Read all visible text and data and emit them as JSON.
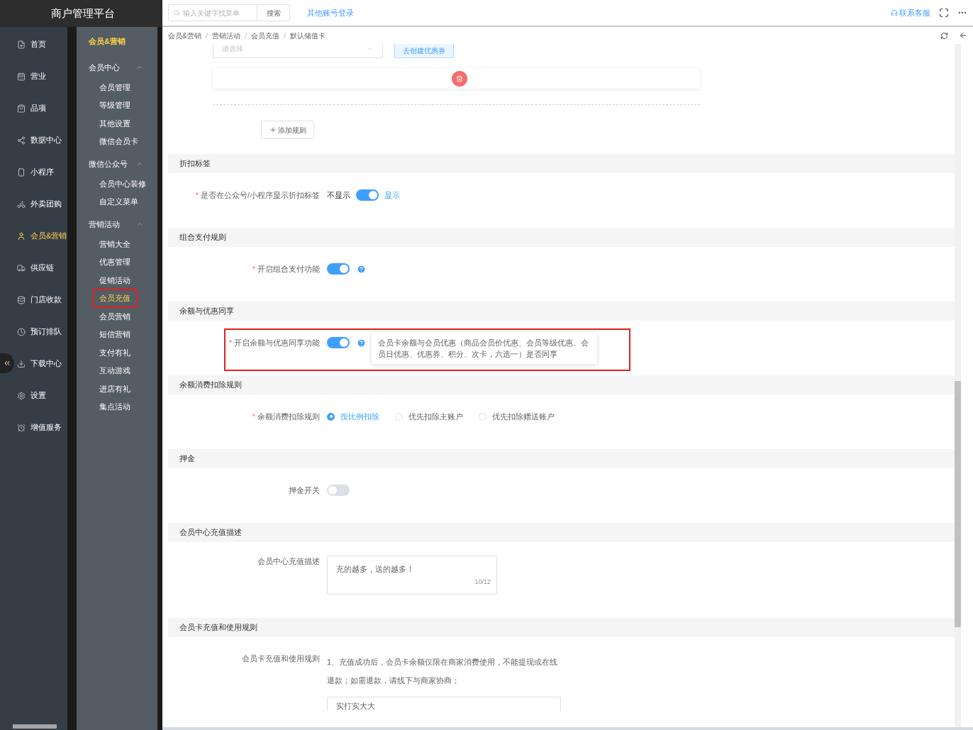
{
  "app_title": "商户管理平台",
  "header": {
    "search_placeholder": "输入关键字找菜单",
    "search_button": "搜索",
    "switch_account": "其他账号登录",
    "support": "联系客服"
  },
  "nav": [
    {
      "label": "首页",
      "selected": false
    },
    {
      "label": "营业",
      "selected": false
    },
    {
      "label": "品项",
      "selected": false
    },
    {
      "label": "数据中心",
      "selected": false
    },
    {
      "label": "小程序",
      "selected": false
    },
    {
      "label": "外卖团购",
      "selected": false
    },
    {
      "label": "会员&营销",
      "selected": true
    },
    {
      "label": "供应链",
      "selected": false
    },
    {
      "label": "门店收款",
      "selected": false
    },
    {
      "label": "预订排队",
      "selected": false
    },
    {
      "label": "下载中心",
      "selected": false
    },
    {
      "label": "设置",
      "selected": false
    },
    {
      "label": "增值服务",
      "selected": false
    }
  ],
  "submenu": {
    "title": "会员&营销",
    "groups": [
      {
        "label": "会员中心",
        "expanded": true,
        "children": [
          {
            "label": "会员管理",
            "selected": false,
            "highlighted": false
          },
          {
            "label": "等级管理",
            "selected": false,
            "highlighted": false
          },
          {
            "label": "其他设置",
            "selected": false,
            "highlighted": false
          },
          {
            "label": "微信会员卡",
            "selected": false,
            "highlighted": false
          }
        ]
      },
      {
        "label": "微信公众号",
        "expanded": true,
        "children": [
          {
            "label": "会员中心装修",
            "selected": false,
            "highlighted": false
          },
          {
            "label": "自定义菜单",
            "selected": false,
            "highlighted": false
          }
        ]
      },
      {
        "label": "营销活动",
        "expanded": true,
        "children": [
          {
            "label": "营销大全",
            "selected": false,
            "highlighted": false
          },
          {
            "label": "优惠管理",
            "selected": false,
            "highlighted": false
          },
          {
            "label": "促销活动",
            "selected": false,
            "highlighted": false
          },
          {
            "label": "会员充值",
            "selected": true,
            "highlighted": true
          },
          {
            "label": "会员营销",
            "selected": false,
            "highlighted": false
          },
          {
            "label": "短信营销",
            "selected": false,
            "highlighted": false
          },
          {
            "label": "支付有礼",
            "selected": false,
            "highlighted": false
          },
          {
            "label": "互动游戏",
            "selected": false,
            "highlighted": false
          },
          {
            "label": "进店有礼",
            "selected": false,
            "highlighted": false
          },
          {
            "label": "集点活动",
            "selected": false,
            "highlighted": false
          }
        ]
      }
    ]
  },
  "breadcrumb": [
    "会员&营销",
    "营销活动",
    "会员充值",
    "默认储值卡"
  ],
  "top_partial": {
    "select_placeholder": "请选择",
    "create_coupon": "去创建优惠券",
    "add_rule": "添加规则"
  },
  "sections": [
    {
      "title": "折扣标签",
      "rows": [
        {
          "kind": "switch",
          "label": "是否在公众号/小程序显示折扣标签",
          "required_mark": "*",
          "on": true,
          "off_text": "不显示",
          "on_text": "显示",
          "help": false,
          "highlighted": false
        }
      ]
    },
    {
      "title": "组合支付规则",
      "rows": [
        {
          "kind": "switch",
          "label": "开启组合支付功能",
          "required_mark": "*",
          "on": true,
          "help": true,
          "highlighted": false
        }
      ]
    },
    {
      "title": "余额与优惠同享",
      "rows": [
        {
          "kind": "switch",
          "label": "开启余额与优惠同享功能",
          "required_mark": "*",
          "on": true,
          "help": true,
          "highlighted": true,
          "tooltip": "会员卡余额与会员优惠（商品会员价优惠、会员等级优惠、会员日优惠、优惠券、积分、次卡，六选一）是否同享"
        }
      ]
    },
    {
      "title": "余额消费扣除规则",
      "rows": [
        {
          "kind": "radio",
          "label": "余额消费扣除规则",
          "required_mark": "*",
          "options": [
            {
              "label": "按比例扣除",
              "selected": true
            },
            {
              "label": "优先扣除主账户",
              "selected": false
            },
            {
              "label": "优先扣除赠送账户",
              "selected": false
            }
          ]
        }
      ]
    },
    {
      "title": "押金",
      "rows": [
        {
          "kind": "switch",
          "label": "押金开关",
          "on": false,
          "help": false,
          "highlighted": false
        }
      ]
    },
    {
      "title": "会员中心充值描述",
      "rows": [
        {
          "kind": "textarea",
          "label": "会员中心充值描述",
          "value": "充的越多，送的越多！",
          "counter": "10/12"
        }
      ]
    },
    {
      "title": "会员卡充值和使用规则",
      "rows": [
        {
          "kind": "rules",
          "label": "会员卡充值和使用规则",
          "text": "1、充值成功后，会员卡余额仅限在商家消费使用，不能提现或在线退款；如需退款，请线下与商家协商；",
          "input_value": "实打实大大"
        }
      ]
    }
  ]
}
